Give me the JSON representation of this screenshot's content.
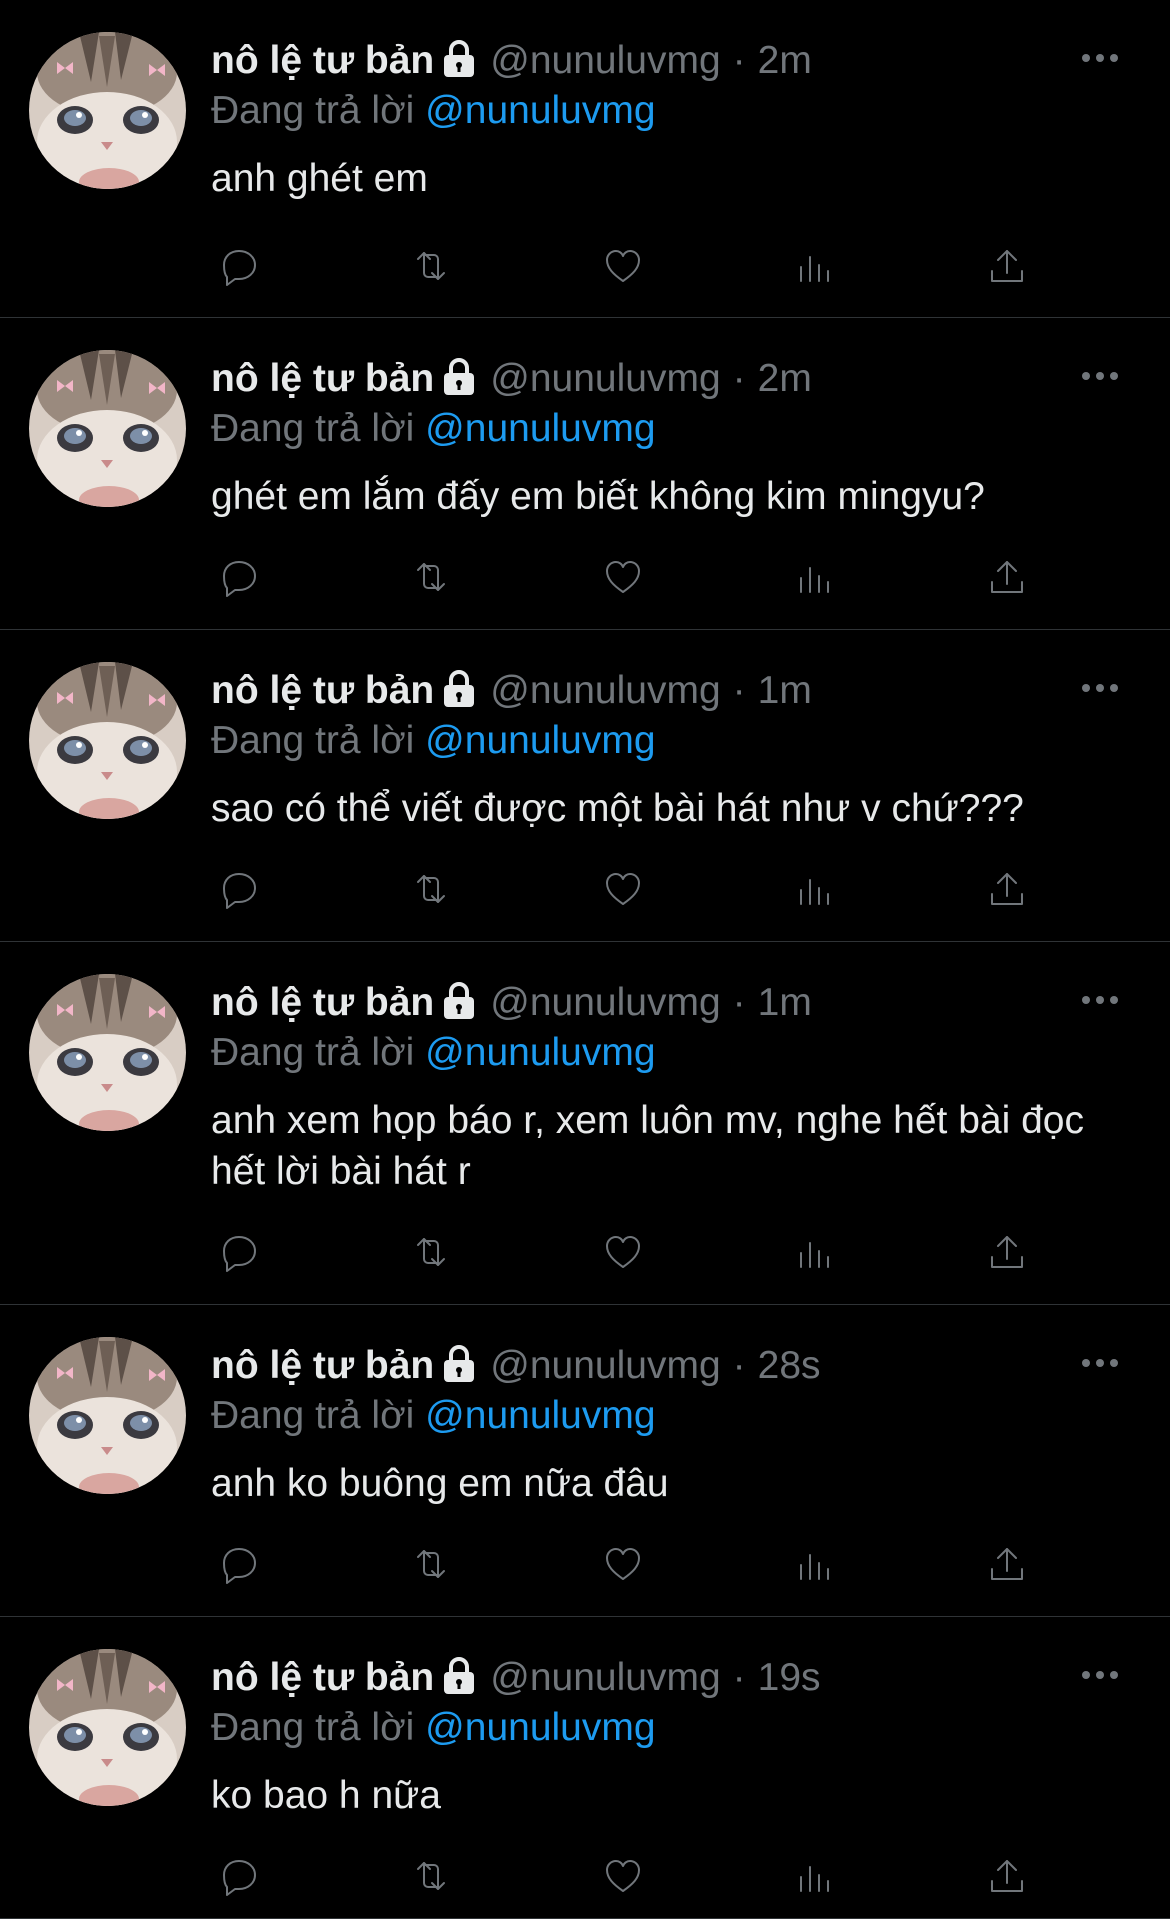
{
  "theme": {
    "background": "#000000",
    "text": "#e7e9ea",
    "muted": "#71767b",
    "accent": "#1d9bf0",
    "divider": "#2f3336"
  },
  "icons": {
    "avatar": "cat-avatar",
    "lock": "lock-icon",
    "more": "more-dots-icon",
    "actions": [
      "reply-icon",
      "retweet-icon",
      "like-icon",
      "views-icon",
      "share-icon"
    ]
  },
  "tweets": [
    {
      "name": "nô lệ tư bản",
      "handle": "@nunuluvmg",
      "dot": "·",
      "time": "2m",
      "reply_prefix": "Đang trả lời",
      "reply_to": "@nunuluvmg",
      "text": "anh ghét em"
    },
    {
      "name": "nô lệ tư bản",
      "handle": "@nunuluvmg",
      "dot": "·",
      "time": "2m",
      "reply_prefix": "Đang trả lời",
      "reply_to": "@nunuluvmg",
      "text": "ghét em lắm đấy em biết không kim mingyu?"
    },
    {
      "name": "nô lệ tư bản",
      "handle": "@nunuluvmg",
      "dot": "·",
      "time": "1m",
      "reply_prefix": "Đang trả lời",
      "reply_to": "@nunuluvmg",
      "text": "sao có thể viết được một bài hát như v chứ???"
    },
    {
      "name": "nô lệ tư bản",
      "handle": "@nunuluvmg",
      "dot": "·",
      "time": "1m",
      "reply_prefix": "Đang trả lời",
      "reply_to": "@nunuluvmg",
      "text": "anh xem họp báo r, xem luôn mv, nghe hết bài đọc hết lời bài hát r"
    },
    {
      "name": "nô lệ tư bản",
      "handle": "@nunuluvmg",
      "dot": "·",
      "time": "28s",
      "reply_prefix": "Đang trả lời",
      "reply_to": "@nunuluvmg",
      "text": "anh ko buông em nữa đâu"
    },
    {
      "name": "nô lệ tư bản",
      "handle": "@nunuluvmg",
      "dot": "·",
      "time": "19s",
      "reply_prefix": "Đang trả lời",
      "reply_to": "@nunuluvmg",
      "text": "ko bao h nữa"
    }
  ]
}
